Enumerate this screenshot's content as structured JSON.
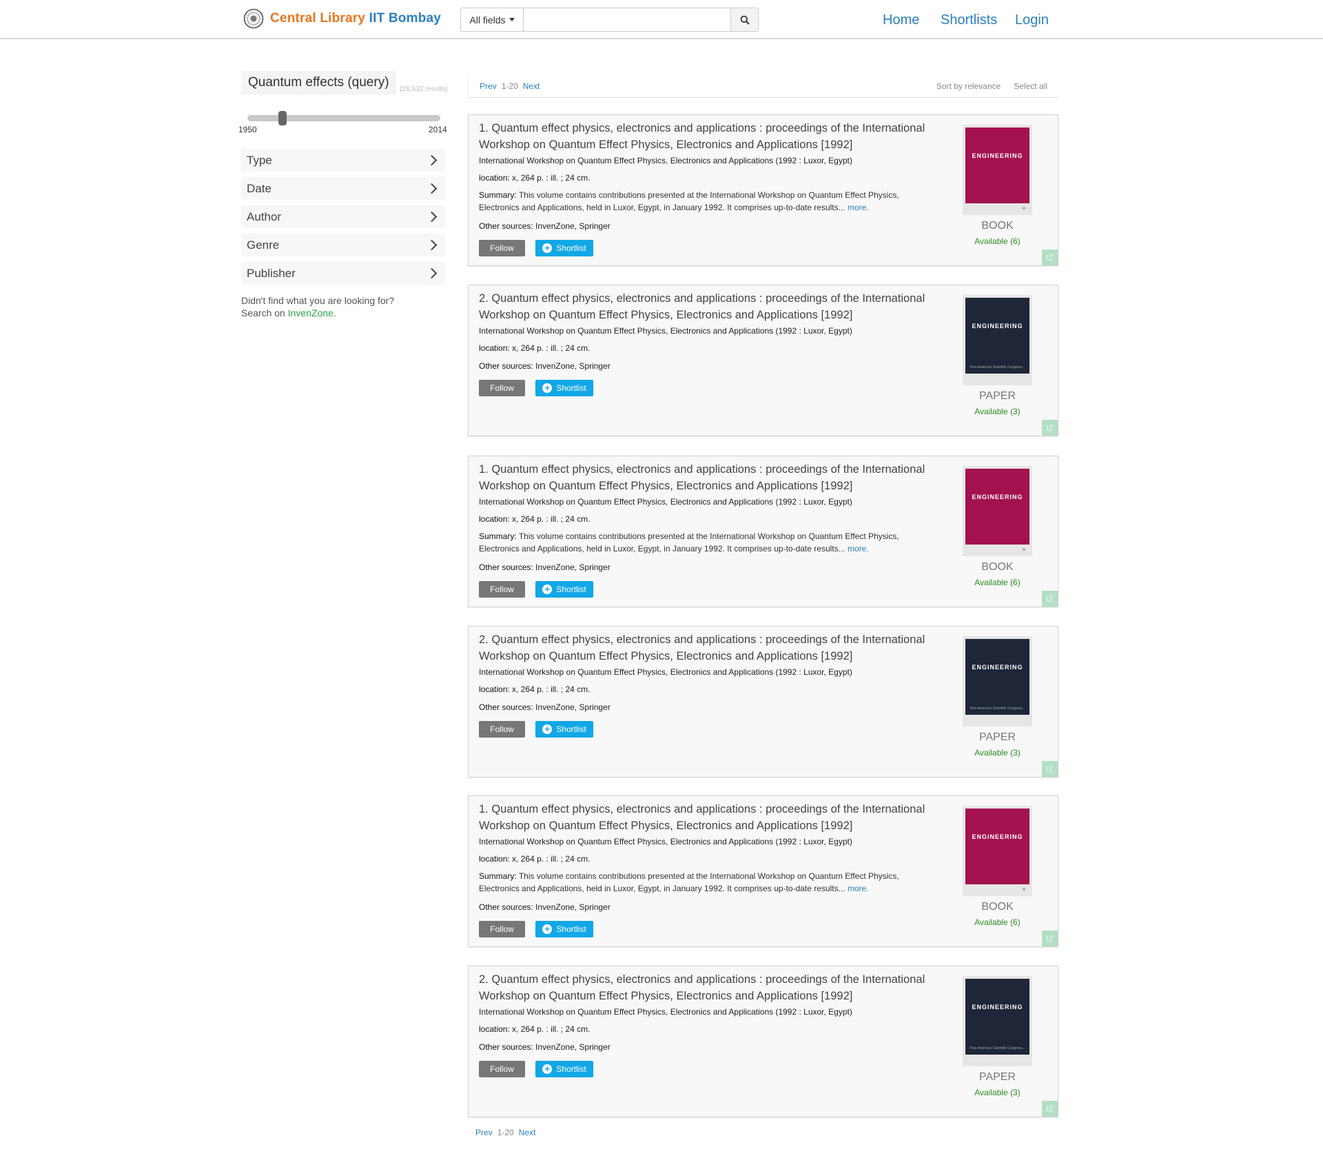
{
  "header": {
    "brand_part1": "Central Library",
    "brand_part2": "IIT Bombay",
    "search_field": "All fields",
    "search_value": "",
    "nav": [
      "Home",
      "Shortlists",
      "Login"
    ]
  },
  "sidebar": {
    "query": "Quantum effects (query)",
    "result_count": "(26,532 results)",
    "year_min": "1950",
    "year_max": "2014",
    "facets": [
      "Type",
      "Date",
      "Author",
      "Genre",
      "Publisher"
    ],
    "notfound_line1": "Didn't find what you are looking for?",
    "notfound_line2": "Search on",
    "notfound_link": "InvenZone."
  },
  "pagination": {
    "prev": "Prev",
    "range": "1-20",
    "next": "Next",
    "sort": "Sort by relevance",
    "select_all": "Select all"
  },
  "results": [
    {
      "title": "1. Quantum effect physics, electronics and applications : proceedings of the International Workshop on Quantum Effect Physics, Electronics and Applications [1992]",
      "author": "International Workshop on Quantum Effect Physics, Electronics and Applications (1992 : Luxor, Egypt)",
      "location_label": "location:",
      "location": "x, 264 p. : ill. ; 24 cm.",
      "summary_label": "Summary:",
      "summary": "This volume contains contributions presented at the International Workshop on Quantum Effect Physics, Electronics and Applications, held in Luxor, Egypt, in January 1992. It comprises up-to-date results...",
      "more": "more.",
      "sources_label": "Other sources:",
      "sources": "InvenZone, Springer",
      "follow": "Follow",
      "shortlist": "Shortlist",
      "cover_label": "ENGINEERING",
      "cover_sub": "",
      "cover_color": "#a3124f",
      "type": "BOOK",
      "availability": "Available (6)",
      "badge": "IZ"
    },
    {
      "title": "2. Quantum effect physics, electronics and applications : proceedings of the International Workshop on Quantum Effect Physics, Electronics and Applications [1992]",
      "author": "International Workshop on Quantum Effect Physics, Electronics and Applications (1992 : Luxor, Egypt)",
      "location_label": "location:",
      "location": "x, 264 p. : ill. ; 24 cm.",
      "sources_label": "Other sources:",
      "sources": "InvenZone, Springer",
      "follow": "Follow",
      "shortlist": "Shortlist",
      "cover_label": "ENGINEERING",
      "cover_sub": "Pan-American Scientific Congress...",
      "cover_color": "#1e2638",
      "type": "PAPER",
      "availability": "Available (3)",
      "badge": "IZ"
    },
    {
      "title": "1. Quantum effect physics, electronics and applications : proceedings of the International Workshop on Quantum Effect Physics, Electronics and Applications [1992]",
      "author": "International Workshop on Quantum Effect Physics, Electronics and Applications (1992 : Luxor, Egypt)",
      "location_label": "location:",
      "location": "x, 264 p. : ill. ; 24 cm.",
      "summary_label": "Summary:",
      "summary": "This volume contains contributions presented at the International Workshop on Quantum Effect Physics, Electronics and Applications, held in Luxor, Egypt, in January 1992. It comprises up-to-date results...",
      "more": "more.",
      "sources_label": "Other sources:",
      "sources": "InvenZone, Springer",
      "follow": "Follow",
      "shortlist": "Shortlist",
      "cover_label": "ENGINEERING",
      "cover_sub": "",
      "cover_color": "#a3124f",
      "type": "BOOK",
      "availability": "Available (6)",
      "badge": "IZ"
    },
    {
      "title": "2. Quantum effect physics, electronics and applications : proceedings of the International Workshop on Quantum Effect Physics, Electronics and Applications [1992]",
      "author": "International Workshop on Quantum Effect Physics, Electronics and Applications (1992 : Luxor, Egypt)",
      "location_label": "location:",
      "location": "x, 264 p. : ill. ; 24 cm.",
      "sources_label": "Other sources:",
      "sources": "InvenZone, Springer",
      "follow": "Follow",
      "shortlist": "Shortlist",
      "cover_label": "ENGINEERING",
      "cover_sub": "Pan-American Scientific Congress...",
      "cover_color": "#1e2638",
      "type": "PAPER",
      "availability": "Available (3)",
      "badge": "IZ"
    },
    {
      "title": "1. Quantum effect physics, electronics and applications : proceedings of the International Workshop on Quantum Effect Physics, Electronics and Applications [1992]",
      "author": "International Workshop on Quantum Effect Physics, Electronics and Applications (1992 : Luxor, Egypt)",
      "location_label": "location:",
      "location": "x, 264 p. : ill. ; 24 cm.",
      "summary_label": "Summary:",
      "summary": "This volume contains contributions presented at the International Workshop on Quantum Effect Physics, Electronics and Applications, held in Luxor, Egypt, in January 1992. It comprises up-to-date results...",
      "more": "more.",
      "sources_label": "Other sources:",
      "sources": "InvenZone, Springer",
      "follow": "Follow",
      "shortlist": "Shortlist",
      "cover_label": "ENGINEERING",
      "cover_sub": "",
      "cover_color": "#a3124f",
      "type": "BOOK",
      "availability": "Available (6)",
      "badge": "IZ"
    },
    {
      "title": "2. Quantum effect physics, electronics and applications : proceedings of the International Workshop on Quantum Effect Physics, Electronics and Applications [1992]",
      "author": "International Workshop on Quantum Effect Physics, Electronics and Applications (1992 : Luxor, Egypt)",
      "location_label": "location:",
      "location": "x, 264 p. : ill. ; 24 cm.",
      "sources_label": "Other sources:",
      "sources": "InvenZone, Springer",
      "follow": "Follow",
      "shortlist": "Shortlist",
      "cover_label": "ENGINEERING",
      "cover_sub": "Pan-American Scientific Congress...",
      "cover_color": "#1e2638",
      "type": "PAPER",
      "availability": "Available (3)",
      "badge": "IZ"
    }
  ]
}
